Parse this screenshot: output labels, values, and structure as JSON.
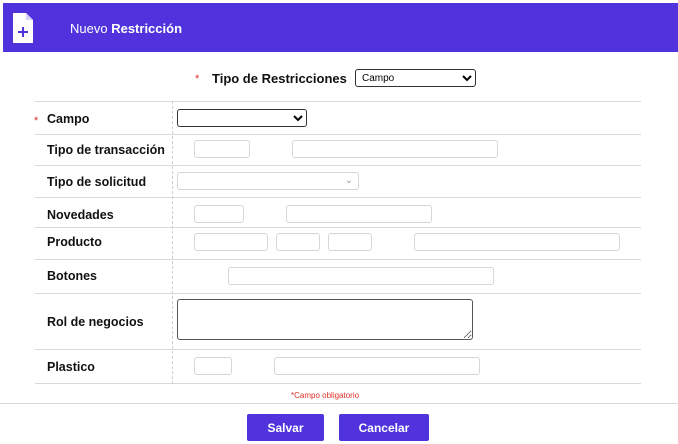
{
  "header": {
    "title_prefix": "Nuevo",
    "title_bold": "Restricción",
    "icon": "document-add-icon",
    "bg_color": "#5033dc"
  },
  "tipo_restricciones": {
    "label": "Tipo de Restricciones",
    "required_mark": "*",
    "selected": "Campo"
  },
  "form": {
    "rows": [
      {
        "label": "Campo",
        "required_mark": "*"
      },
      {
        "label": "Tipo de transacción"
      },
      {
        "label": "Tipo de solicitud"
      },
      {
        "label": "Novedades"
      },
      {
        "label": "Producto"
      },
      {
        "label": "Botones"
      },
      {
        "label": "Rol de negocios"
      },
      {
        "label": "Plastico"
      }
    ],
    "campo_selected": ""
  },
  "footnote": {
    "mark": "*",
    "text": "Campo obligatorio"
  },
  "buttons": {
    "save": "Salvar",
    "cancel": "Cancelar"
  },
  "colors": {
    "accent": "#5033dc",
    "required": "#e0302a"
  }
}
